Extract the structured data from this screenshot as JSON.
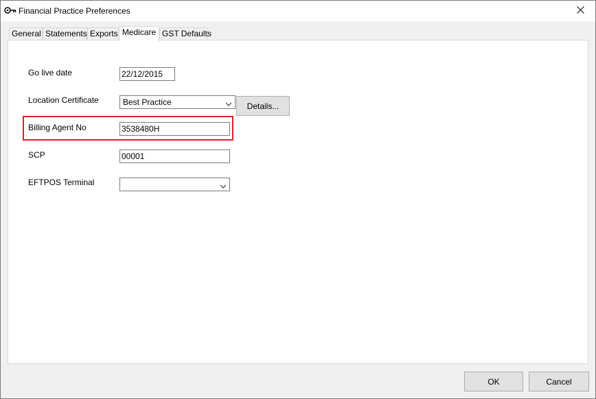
{
  "window": {
    "title": "Financial Practice Preferences"
  },
  "tabs": [
    {
      "label": "General"
    },
    {
      "label": "Statements"
    },
    {
      "label": "Exports"
    },
    {
      "label": "Medicare"
    },
    {
      "label": "GST Defaults"
    }
  ],
  "active_tab": "Medicare",
  "form": {
    "go_live_date": {
      "label": "Go live date",
      "value": "22/12/2015"
    },
    "location_certificate": {
      "label": "Location Certificate",
      "value": "Best Practice"
    },
    "details_button": "Details...",
    "billing_agent_no": {
      "label": "Billing Agent No",
      "value": "3538480H"
    },
    "scp": {
      "label": "SCP",
      "value": "00001"
    },
    "eftpos_terminal": {
      "label": "EFTPOS Terminal",
      "value": ""
    }
  },
  "buttons": {
    "ok": "OK",
    "cancel": "Cancel"
  },
  "icons": {
    "title": "key-icon",
    "close": "close-icon",
    "dropdown": "chevron-down-icon"
  },
  "colors": {
    "highlight": "#d9202a",
    "panel_bg": "#ffffff",
    "dialog_bg": "#f0f0f0"
  }
}
